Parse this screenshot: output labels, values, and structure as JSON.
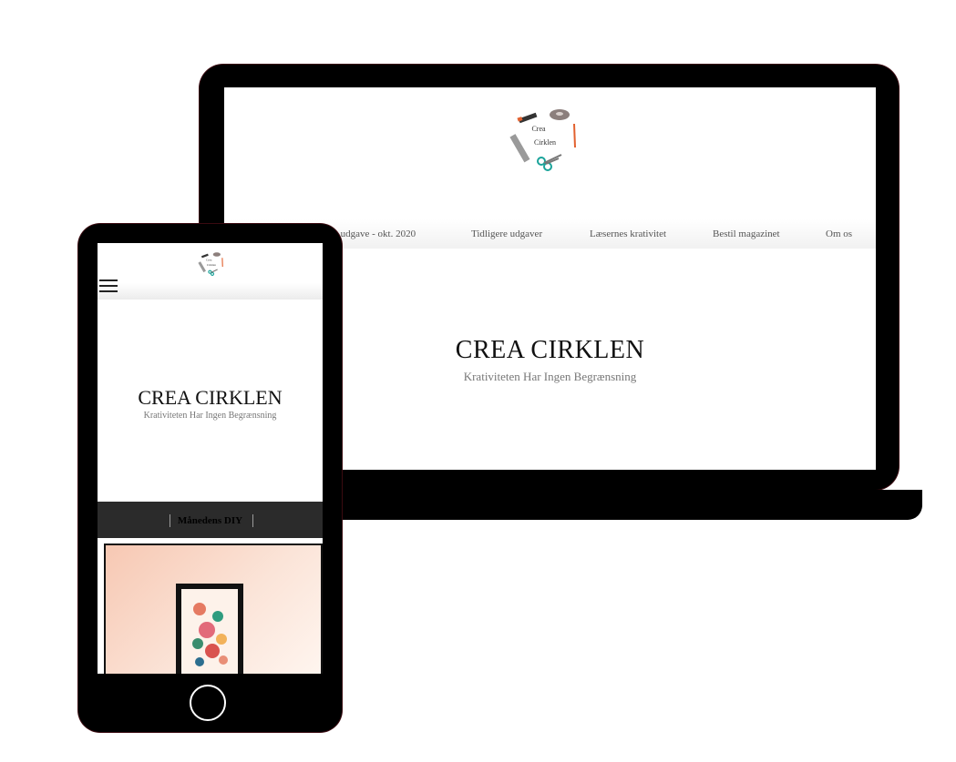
{
  "laptop": {
    "logo_line1": "Crea",
    "logo_line2": "Cirklen",
    "nav": [
      "e udgave - okt. 2020",
      "Tidligere udgaver",
      "Læsernes krativitet",
      "Bestil magazinet",
      "Om os"
    ],
    "title": "CREA CIRKLEN",
    "subtitle": "Krativiteten Har Ingen Begrænsning"
  },
  "phone": {
    "logo_line1": "Crea",
    "logo_line2": "Cirklen",
    "menu_icon": "hamburger-icon",
    "title": "CREA CIRKLEN",
    "subtitle": "Krativiteten Har Ingen Begrænsning",
    "section_label": "Månedens DIY"
  },
  "colors": {
    "device_frame": "#000000",
    "dark_band": "#2b2b2b",
    "accent_teal": "#1aa39a",
    "accent_orange": "#e2612f"
  }
}
